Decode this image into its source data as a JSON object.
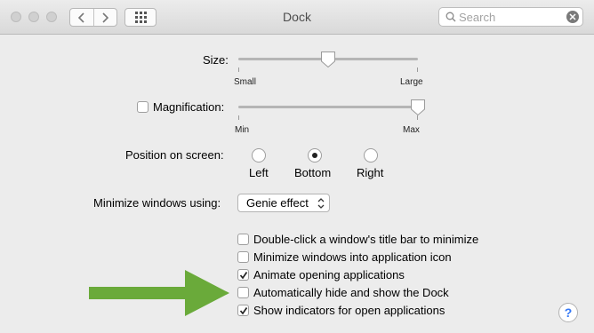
{
  "window": {
    "title": "Dock"
  },
  "toolbar": {
    "back_icon": "chevron-left-icon",
    "forward_icon": "chevron-right-icon",
    "show_all_icon": "grid-icon",
    "search_placeholder": "Search"
  },
  "size": {
    "label": "Size:",
    "min_label": "Small",
    "max_label": "Large",
    "value": 0.5
  },
  "magnification": {
    "label": "Magnification:",
    "checked": false,
    "min_label": "Min",
    "max_label": "Max",
    "value": 1.0
  },
  "position": {
    "label": "Position on screen:",
    "options": [
      {
        "label": "Left",
        "selected": false
      },
      {
        "label": "Bottom",
        "selected": true
      },
      {
        "label": "Right",
        "selected": false
      }
    ]
  },
  "minimize": {
    "label": "Minimize windows using:",
    "value": "Genie effect"
  },
  "checkboxes": [
    {
      "label": "Double-click a window's title bar to minimize",
      "checked": false
    },
    {
      "label": "Minimize windows into application icon",
      "checked": false
    },
    {
      "label": "Animate opening applications",
      "checked": true
    },
    {
      "label": "Automatically hide and show the Dock",
      "checked": false
    },
    {
      "label": "Show indicators for open applications",
      "checked": true
    }
  ],
  "annotation": {
    "arrow_color": "#6aaa3a"
  },
  "help": {
    "label": "?"
  }
}
